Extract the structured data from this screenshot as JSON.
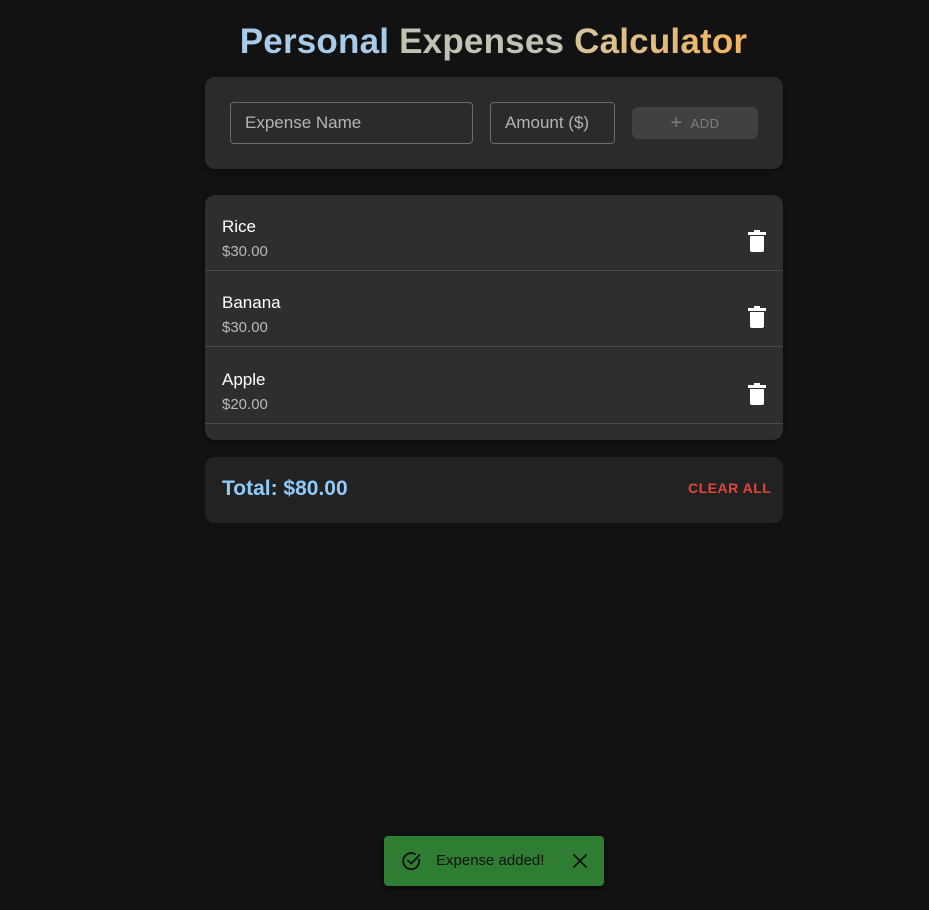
{
  "header": {
    "title_part1": "Personal",
    "title_part2": "Expenses",
    "title_part3": "Calculator"
  },
  "form": {
    "name_placeholder": "Expense Name",
    "amount_placeholder": "Amount ($)",
    "add_label": "ADD",
    "add_icon": "plus-icon"
  },
  "expenses": [
    {
      "name": "Rice",
      "amount": "$30.00"
    },
    {
      "name": "Banana",
      "amount": "$30.00"
    },
    {
      "name": "Apple",
      "amount": "$20.00"
    }
  ],
  "summary": {
    "total_text": "Total: $80.00",
    "clear_label": "CLEAR ALL"
  },
  "toast": {
    "message": "Expense added!",
    "icon": "check-circle-icon"
  },
  "colors": {
    "background": "#121212",
    "accent_blue": "#90caf9",
    "danger_red": "#e0473b",
    "success_green": "#2e7d32"
  }
}
